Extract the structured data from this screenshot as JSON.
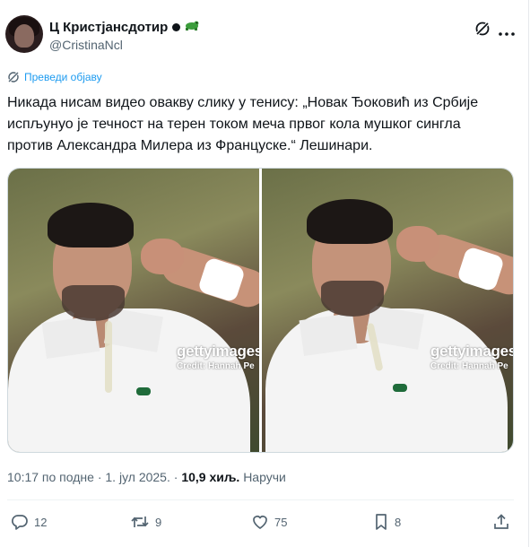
{
  "author": {
    "display_name": "Ц Кристјансдотир",
    "handle": "@CristinaNcl"
  },
  "translate_label": "Преведи објаву",
  "tweet": {
    "line1": "Никада нисам видео овакву слику у тенису: „Новак Ђоковић из Србије",
    "line2": "испљунуо је течност на терен током меча првог кола мушког сингла",
    "line3": "против Александра Милера из Француске.“ Лешинари."
  },
  "media": [
    {
      "watermark": "gettyimages",
      "credit": "Credit: Hannah Pe"
    },
    {
      "watermark": "gettyimages",
      "credit": "Credit: Hannah Pe"
    }
  ],
  "meta": {
    "time": "10:17 по подне",
    "date": "1. јул 2025.",
    "views": "10,9 хиљ.",
    "views_label": "Наручи",
    "sep": "·"
  },
  "actions": {
    "replies": "12",
    "reposts": "9",
    "likes": "75",
    "bookmarks": "8"
  },
  "colors": {
    "accent": "#1d9bf0",
    "text": "#0f1419",
    "muted": "#536471"
  }
}
